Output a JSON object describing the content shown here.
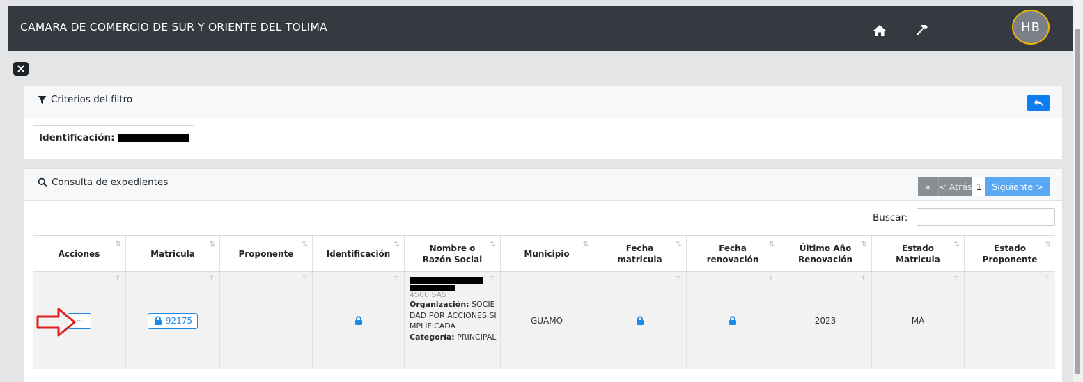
{
  "header": {
    "brand": "CAMARA DE COMERCIO DE SUR Y ORIENTE DEL TOLIMA",
    "avatar_initials": "HB",
    "icons": [
      "home-icon",
      "hammer-icon"
    ]
  },
  "filter_card": {
    "title": "Criterios del filtro",
    "title_icon": "filter-icon",
    "back_icon": "reply-icon",
    "criteria_label": "Identificación:"
  },
  "results_card": {
    "title": "Consulta de expedientes",
    "title_icon": "search-icon",
    "pager": {
      "first": "«",
      "prev": "< Atrás",
      "current": "1",
      "next": "Siguiente >"
    },
    "search_label": "Buscar:",
    "search_value": "",
    "columns": [
      "Acciones",
      "Matricula",
      "Proponente",
      "Identificación",
      "Nombre o Razón Social",
      "Municipio",
      "Fecha matricula",
      "Fecha renovación",
      "Último Año Renovación",
      "Estado Matricula",
      "Estado Proponente"
    ],
    "row": {
      "action_label": "···",
      "matricula": "92175",
      "proponente": "",
      "name_partial": "4500 SAS",
      "org_label": "Organización:",
      "org_value": "SOCIEDAD POR ACCIONES SIMPLIFICADA",
      "cat_label": "Categoría:",
      "cat_value": "PRINCIPAL",
      "municipio": "GUAMO",
      "ultimo_anio": "2023",
      "estado_matricula": "MA",
      "estado_proponente": ""
    }
  },
  "colors": {
    "topbar": "#343a40",
    "primary": "#1a8ae6",
    "annotation": "#e01e1e"
  }
}
